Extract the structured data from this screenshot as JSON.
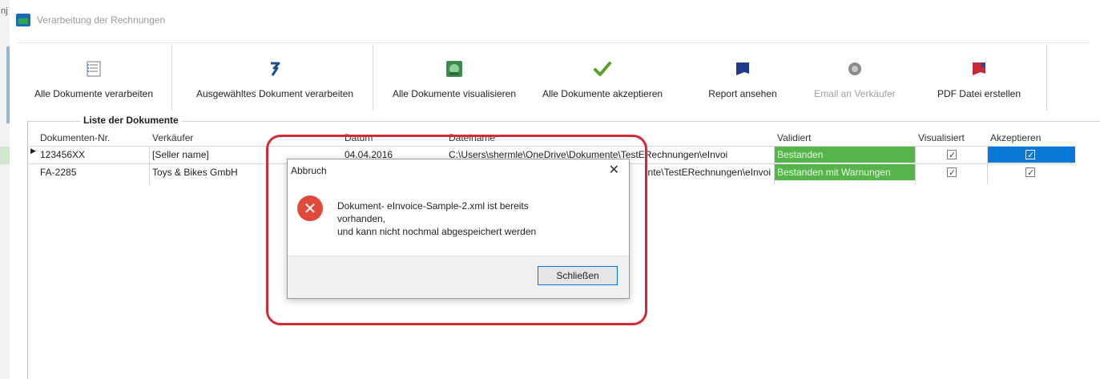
{
  "left_strip_char": "nj",
  "app": {
    "title": "Verarbeitung der  Rechnungen"
  },
  "ribbon": [
    {
      "label": "Alle Dokumente verarbeiten",
      "icon": "document-list-icon",
      "enabled": true
    },
    {
      "label": "Ausgewähltes Dokument verarbeiten",
      "icon": "process-arrow-icon",
      "enabled": true
    },
    {
      "label": "Alle Dokumente visualisieren",
      "icon": "visualize-icon",
      "enabled": true
    },
    {
      "label": "Alle Dokumente akzeptieren",
      "icon": "checkmark-icon",
      "enabled": true
    },
    {
      "label": "Report ansehen",
      "icon": "report-icon",
      "enabled": true
    },
    {
      "label": "Email an Verkäufer",
      "icon": "email-icon",
      "enabled": false
    },
    {
      "label": "PDF Datei erstellen",
      "icon": "pdf-icon",
      "enabled": true
    }
  ],
  "section": {
    "label": "Liste der Dokumente"
  },
  "grid": {
    "columns": [
      "Dokumenten-Nr.",
      "Verkäufer",
      "Datum",
      "Dateiname",
      "Validiert",
      "Visualisiert",
      "Akzeptieren"
    ],
    "rows": [
      {
        "nr": "123456XX",
        "seller": "[Seller name]",
        "date": "04.04.2016",
        "file": "C:\\Users\\shermle\\OneDrive\\Dokumente\\TestERechnungen\\eInvoi",
        "validated": "Bestanden",
        "visualized": true,
        "accepted": true,
        "current": true
      },
      {
        "nr": "FA-2285",
        "seller": "Toys & Bikes GmbH",
        "date": "",
        "file": "nte\\TestERechnungen\\eInvoi",
        "validated": "Bestanden mit Warnungen",
        "visualized": true,
        "accepted": true,
        "current": false
      }
    ]
  },
  "dialog": {
    "title": "Abbruch",
    "icon": "error-icon",
    "message_lines": [
      "Dokument- eInvoice-Sample-2.xml ist bereits",
      "vorhanden,",
      "und kann nicht nochmal abgespeichert werden"
    ],
    "button": "Schließen"
  },
  "colors": {
    "highlight": "#d12b3a",
    "validated_ok": "#55b54a",
    "selection": "#0a78d7",
    "error": "#e04a3c"
  }
}
